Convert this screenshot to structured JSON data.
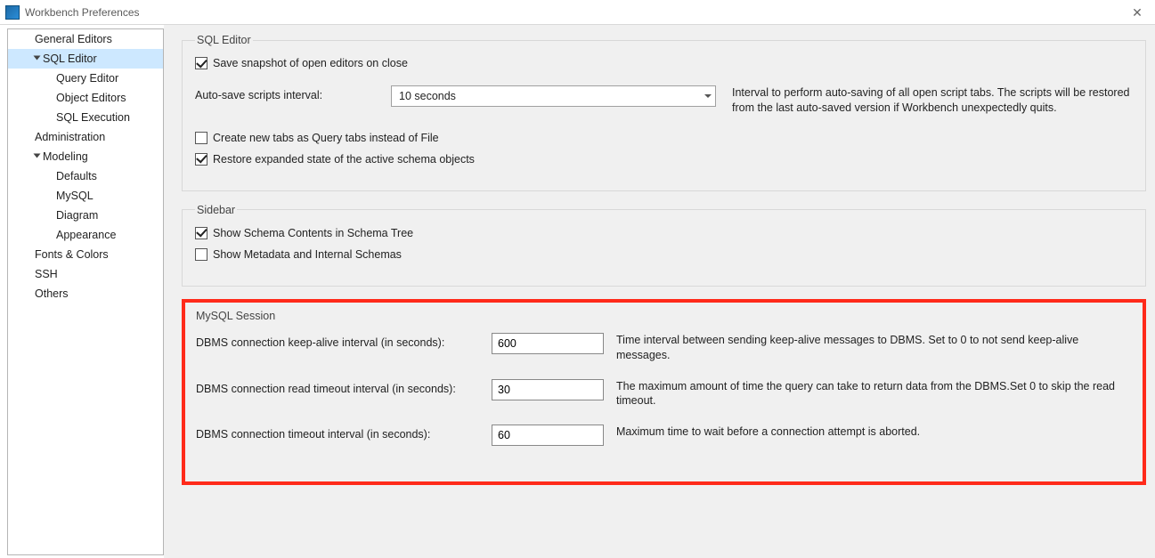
{
  "window": {
    "title": "Workbench Preferences"
  },
  "nav": {
    "items": [
      {
        "label": "General Editors",
        "level": 1,
        "expand": false
      },
      {
        "label": "SQL Editor",
        "level": 1,
        "expand": true,
        "selected": true
      },
      {
        "label": "Query Editor",
        "level": 2
      },
      {
        "label": "Object Editors",
        "level": 2
      },
      {
        "label": "SQL Execution",
        "level": 2
      },
      {
        "label": "Administration",
        "level": 1,
        "expand": false
      },
      {
        "label": "Modeling",
        "level": 1,
        "expand": true
      },
      {
        "label": "Defaults",
        "level": 2
      },
      {
        "label": "MySQL",
        "level": 2
      },
      {
        "label": "Diagram",
        "level": 2
      },
      {
        "label": "Appearance",
        "level": 2
      },
      {
        "label": "Fonts & Colors",
        "level": 1,
        "expand": false
      },
      {
        "label": "SSH",
        "level": 1,
        "expand": false
      },
      {
        "label": "Others",
        "level": 1,
        "expand": false
      }
    ]
  },
  "sqlEditor": {
    "legend": "SQL Editor",
    "saveSnapshot": {
      "label": "Save snapshot of open editors on close",
      "checked": true
    },
    "autoSaveLabel": "Auto-save scripts interval:",
    "autoSaveValue": "10 seconds",
    "autoSaveDesc": "Interval to perform auto-saving of all open script tabs. The scripts will be restored from the last auto-saved version if Workbench unexpectedly quits.",
    "createTabs": {
      "label": "Create new tabs as Query tabs instead of File",
      "checked": false
    },
    "restoreExpanded": {
      "label": "Restore expanded state of the active schema objects",
      "checked": true
    }
  },
  "sidebarGroup": {
    "legend": "Sidebar",
    "showSchema": {
      "label": "Show Schema Contents in Schema Tree",
      "checked": true
    },
    "showMeta": {
      "label": "Show Metadata and Internal Schemas",
      "checked": false
    }
  },
  "mysqlSession": {
    "legend": "MySQL Session",
    "keepAlive": {
      "label": "DBMS connection keep-alive interval (in seconds):",
      "value": "600",
      "desc": "Time interval between sending keep-alive messages to DBMS. Set to 0 to not send keep-alive messages."
    },
    "readTimeout": {
      "label": "DBMS connection read timeout interval (in seconds):",
      "value": "30",
      "desc": "The maximum amount of time the query can take to return data from the DBMS.Set 0 to skip the read timeout."
    },
    "connTimeout": {
      "label": "DBMS connection timeout interval (in seconds):",
      "value": "60",
      "desc": "Maximum time to wait before a connection attempt is aborted."
    }
  }
}
